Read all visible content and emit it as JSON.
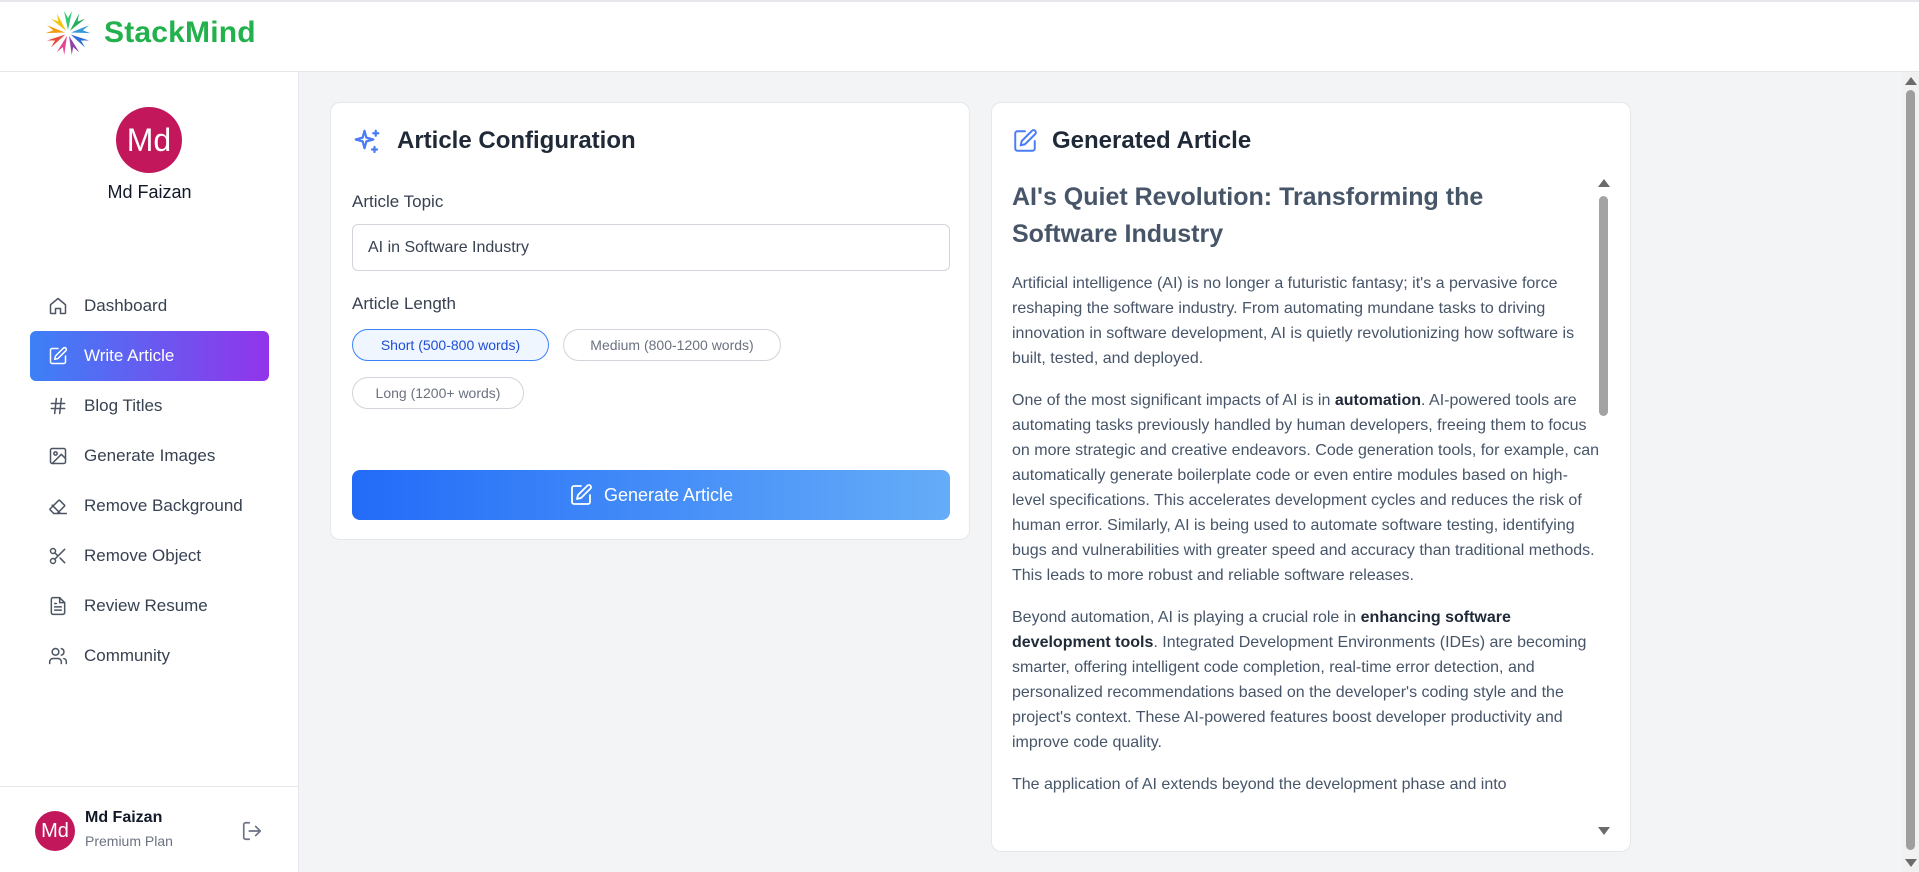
{
  "brand": {
    "name": "StackMind"
  },
  "sidebar": {
    "profile": {
      "initials": "Md",
      "name": "Md Faizan"
    },
    "items": [
      {
        "label": "Dashboard",
        "icon": "home-icon"
      },
      {
        "label": "Write Article",
        "icon": "edit-icon"
      },
      {
        "label": "Blog Titles",
        "icon": "hash-icon"
      },
      {
        "label": "Generate Images",
        "icon": "image-icon"
      },
      {
        "label": "Remove Background",
        "icon": "eraser-icon"
      },
      {
        "label": "Remove Object",
        "icon": "scissors-icon"
      },
      {
        "label": "Review Resume",
        "icon": "file-text-icon"
      },
      {
        "label": "Community",
        "icon": "users-icon"
      }
    ],
    "active_item": "Write Article",
    "footer": {
      "initials": "Md",
      "name": "Md Faizan",
      "plan": "Premium Plan"
    }
  },
  "config": {
    "title": "Article Configuration",
    "topic_label": "Article Topic",
    "topic_value": "AI in Software Industry",
    "length_label": "Article Length",
    "length_options": [
      "Short (500-800 words)",
      "Medium (800-1200 words)",
      "Long (1200+ words)"
    ],
    "selected_length": "Short (500-800 words)",
    "generate_label": "Generate Article"
  },
  "generated": {
    "title": "Generated Article",
    "article_title": "AI's Quiet Revolution: Transforming the Software Industry",
    "p1": "Artificial intelligence (AI) is no longer a futuristic fantasy; it's a pervasive force reshaping the software industry. From automating mundane tasks to driving innovation in software development, AI is quietly revolutionizing how software is built, tested, and deployed.",
    "p2_a": "One of the most significant impacts of AI is in ",
    "p2_bold": "automation",
    "p2_b": ". AI-powered tools are automating tasks previously handled by human developers, freeing them to focus on more strategic and creative endeavors. Code generation tools, for example, can automatically generate boilerplate code or even entire modules based on high-level specifications. This accelerates development cycles and reduces the risk of human error. Similarly, AI is being used to automate software testing, identifying bugs and vulnerabilities with greater speed and accuracy than traditional methods. This leads to more robust and reliable software releases.",
    "p3_a": "Beyond automation, AI is playing a crucial role in ",
    "p3_bold": "enhancing software development tools",
    "p3_b": ". Integrated Development Environments (IDEs) are becoming smarter, offering intelligent code completion, real-time error detection, and personalized recommendations based on the developer's coding style and the project's context. These AI-powered features boost developer productivity and improve code quality.",
    "p4": "The application of AI extends beyond the development phase and into"
  },
  "colors": {
    "brand_green": "#22b14c",
    "active_gradient_start": "#3c81f6",
    "active_gradient_end": "#9234ea",
    "button_start": "#226bf8",
    "button_end": "#65adf8",
    "avatar": "#c2185b"
  }
}
